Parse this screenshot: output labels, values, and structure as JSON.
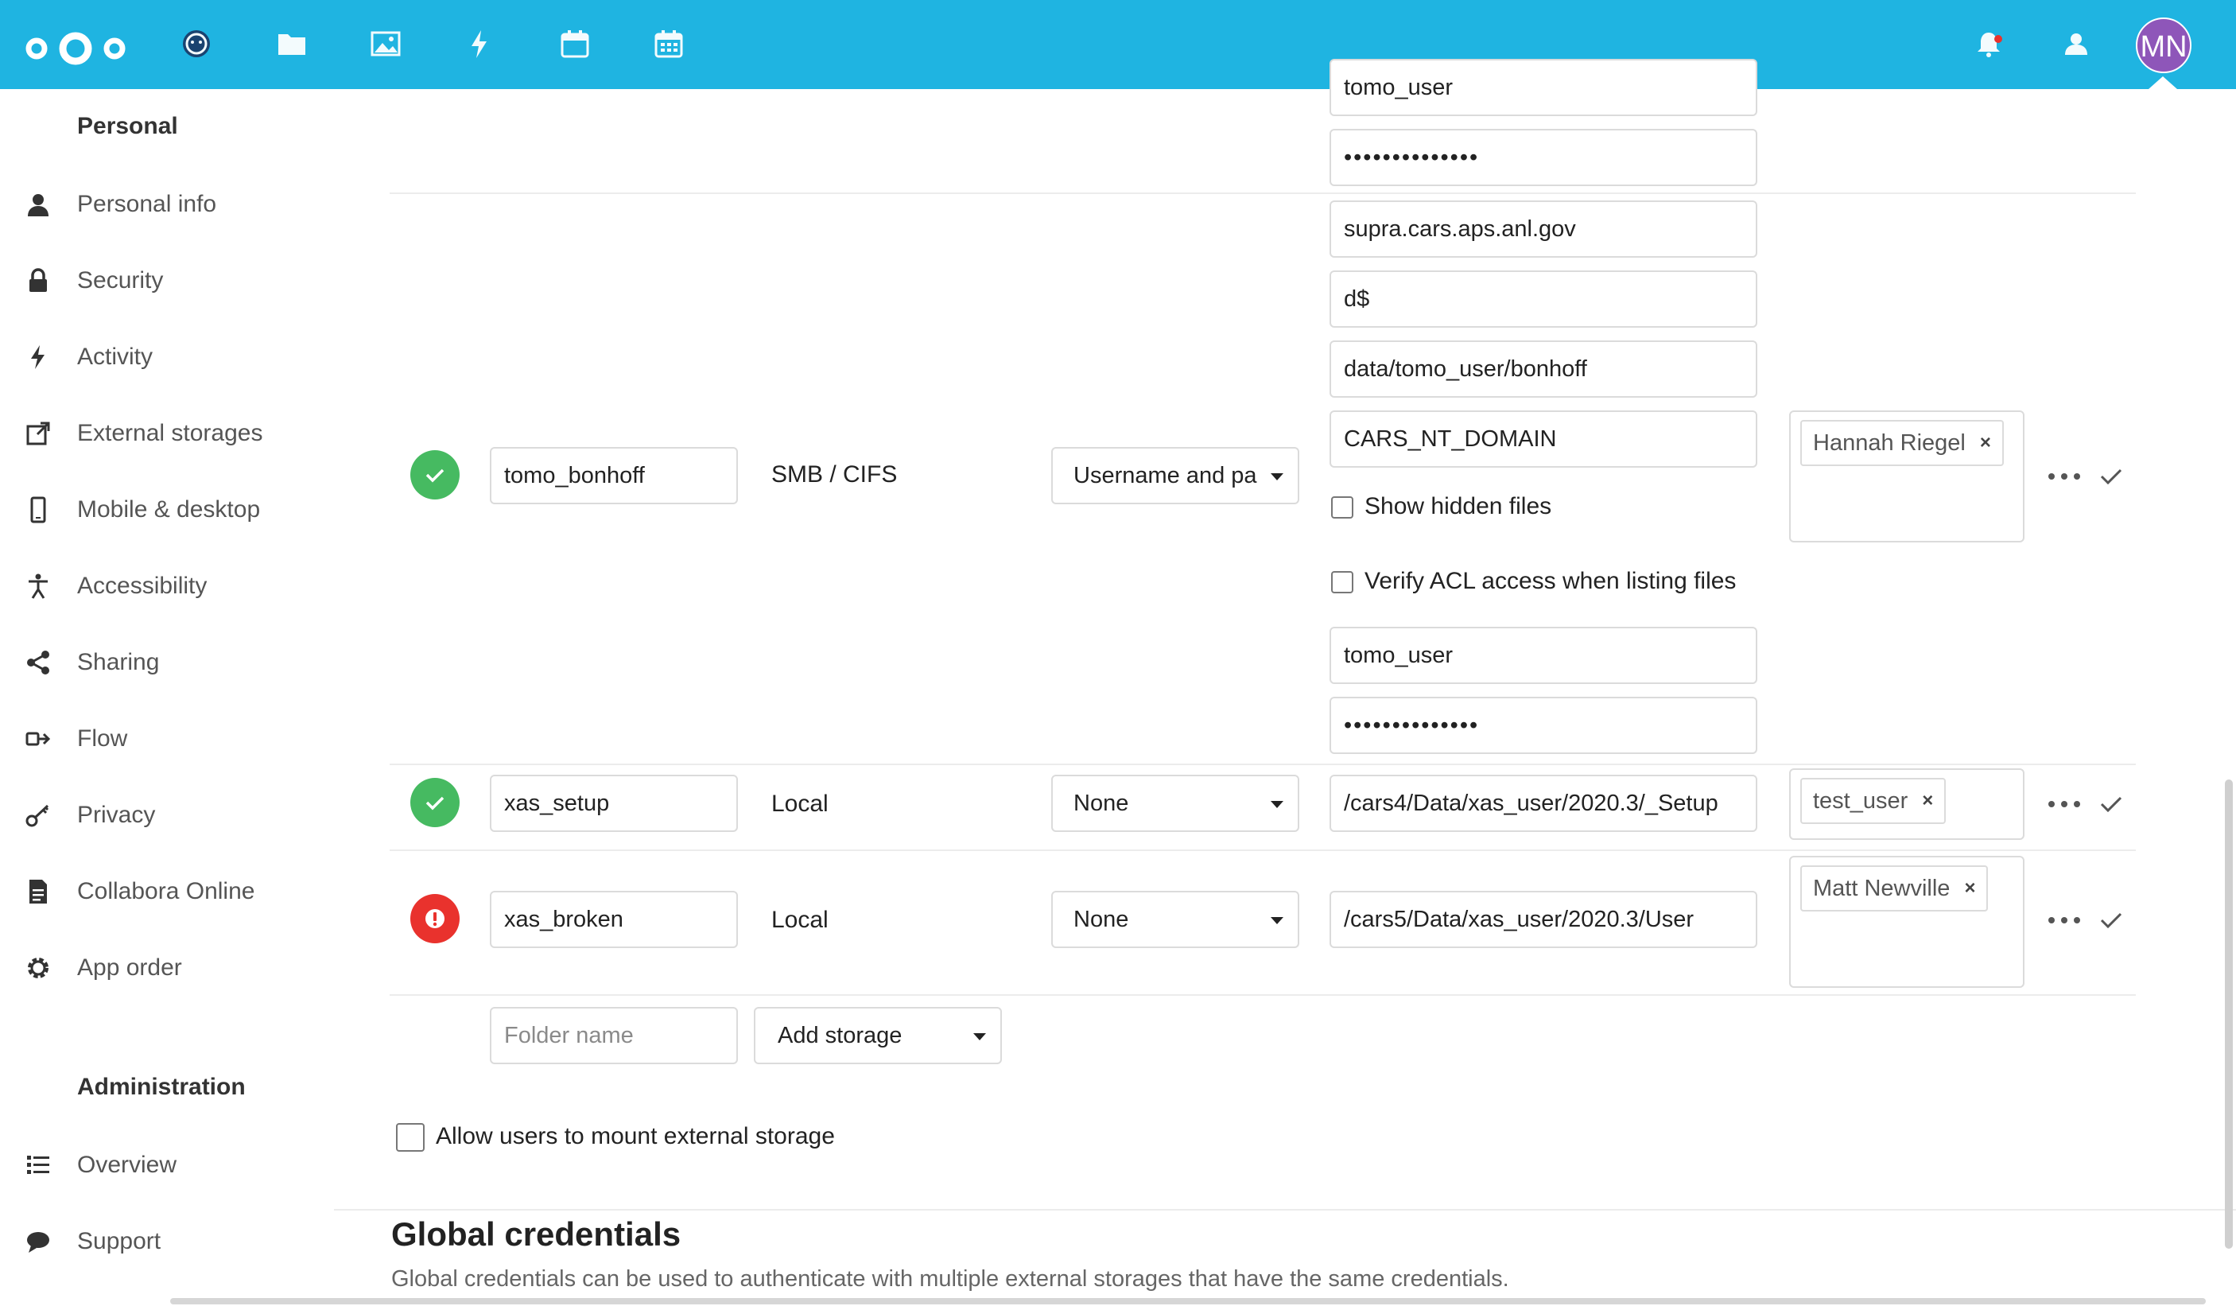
{
  "header": {
    "avatar_initials": "MN",
    "brand_color": "#1fb4e1",
    "apps": [
      "dashboard-icon",
      "files-icon",
      "photos-icon",
      "activity-icon",
      "calendar-icon",
      "deck-icon"
    ],
    "right_icons": [
      "notifications-icon",
      "contacts-icon"
    ]
  },
  "sidebar": {
    "personal_heading": "Personal",
    "admin_heading": "Administration",
    "items": [
      {
        "label": "Personal info",
        "icon": "user-icon"
      },
      {
        "label": "Security",
        "icon": "lock-icon"
      },
      {
        "label": "Activity",
        "icon": "activity-icon"
      },
      {
        "label": "External storages",
        "icon": "external-link-icon"
      },
      {
        "label": "Mobile & desktop",
        "icon": "phone-icon"
      },
      {
        "label": "Accessibility",
        "icon": "accessibility-icon"
      },
      {
        "label": "Sharing",
        "icon": "share-icon"
      },
      {
        "label": "Flow",
        "icon": "flow-icon"
      },
      {
        "label": "Privacy",
        "icon": "key-icon"
      },
      {
        "label": "Collabora Online",
        "icon": "document-icon"
      },
      {
        "label": "App order",
        "icon": "gear-icon"
      }
    ],
    "admin_items": [
      {
        "label": "Overview",
        "icon": "list-icon"
      },
      {
        "label": "Support",
        "icon": "speech-bubble-icon"
      }
    ]
  },
  "storages": {
    "top_partial": {
      "user": "tomo_user",
      "password": "••••••••••••••"
    },
    "row1": {
      "folder": "tomo_bonhoff",
      "backend": "SMB / CIFS",
      "auth": "Username and pa",
      "host": "supra.cars.aps.anl.gov",
      "share": "d$",
      "remote_subfolder": "data/tomo_user/bonhoff",
      "domain": "CARS_NT_DOMAIN",
      "show_hidden_label": "Show hidden files",
      "verify_acl_label": "Verify ACL access when listing files",
      "user": "tomo_user",
      "password": "••••••••••••••",
      "applicable": "Hannah Riegel",
      "status": "ok"
    },
    "row2": {
      "folder": "xas_setup",
      "backend": "Local",
      "auth": "None",
      "location": "/cars4/Data/xas_user/2020.3/_Setup",
      "applicable": "test_user",
      "status": "ok"
    },
    "row3": {
      "folder": "xas_broken",
      "backend": "Local",
      "auth": "None",
      "location": "/cars5/Data/xas_user/2020.3/User",
      "applicable": "Matt Newville",
      "status": "error"
    },
    "new_row": {
      "folder_placeholder": "Folder name",
      "add_storage_label": "Add storage"
    },
    "chip_remove": "×"
  },
  "allow_mount_label": "Allow users to mount external storage",
  "global_credentials": {
    "title": "Global credentials",
    "description": "Global credentials can be used to authenticate with multiple external storages that have the same credentials."
  },
  "colors": {
    "ok": "#46ba61",
    "error": "#e9322d",
    "avatar": "#8e56b9"
  }
}
